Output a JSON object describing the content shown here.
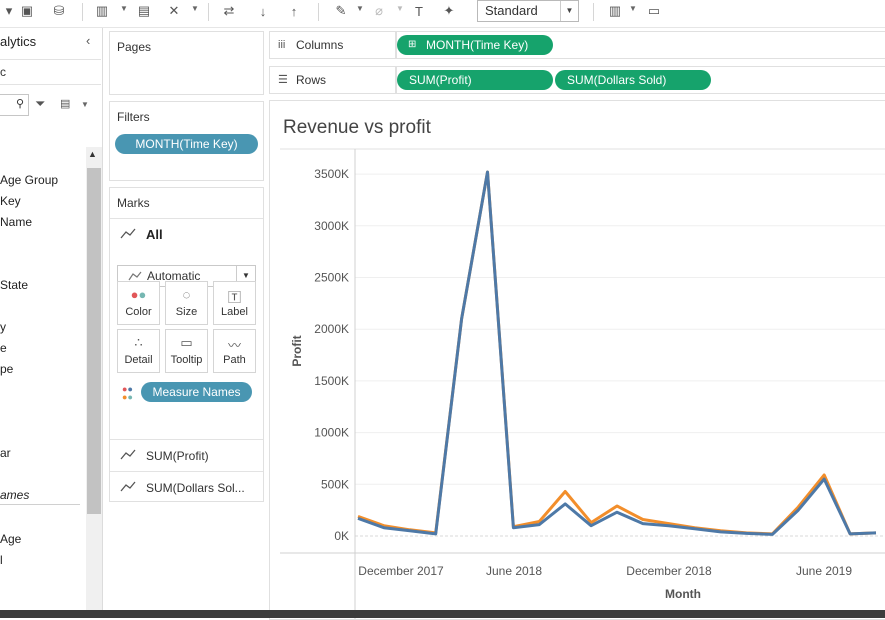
{
  "toolbar": {
    "view_size_select": "Standard"
  },
  "left_pane": {
    "title": "alytics",
    "search_text": "c",
    "field_list": [
      "Age Group",
      "Key",
      "Name",
      "State",
      "y",
      "e",
      "pe",
      "ar",
      "ames",
      "Age",
      "l"
    ]
  },
  "cards": {
    "pages": "Pages",
    "filters": "Filters",
    "filters_pill": "MONTH(Time Key)",
    "marks": "Marks",
    "marks_all": "All",
    "mark_type": "Automatic",
    "mark_buttons": {
      "color": "Color",
      "size": "Size",
      "label": "Label",
      "detail": "Detail",
      "tooltip": "Tooltip",
      "path": "Path"
    },
    "measure_names_pill": "Measure Names",
    "measure_rows": [
      "SUM(Profit)",
      "SUM(Dollars Sol..."
    ]
  },
  "shelves": {
    "columns_label": "Columns",
    "rows_label": "Rows",
    "columns_pill": "MONTH(Time Key)",
    "rows_pills": [
      "SUM(Profit)",
      "SUM(Dollars Sold)"
    ]
  },
  "colors": {
    "pill_blue": "#4996b2",
    "pill_green": "#16a36c",
    "series_blue": "#4e79a7",
    "series_orange": "#f28e2b"
  },
  "chart_data": {
    "type": "line",
    "title": "Revenue vs profit",
    "xlabel": "Month",
    "ylabel": "Profit",
    "x_tick_labels": [
      "December 2017",
      "June 2018",
      "December 2018",
      "June 2019"
    ],
    "y_tick_labels": [
      "0K",
      "500K",
      "1000K",
      "1500K",
      "2000K",
      "2500K",
      "3000K",
      "3500K"
    ],
    "ylim": [
      0,
      3600000
    ],
    "grid": true,
    "x": [
      "2017-10",
      "2017-11",
      "2017-12",
      "2018-01",
      "2018-02",
      "2018-03",
      "2018-04",
      "2018-05",
      "2018-06",
      "2018-07",
      "2018-08",
      "2018-09",
      "2018-10",
      "2018-11",
      "2018-12",
      "2019-01",
      "2019-02",
      "2019-03",
      "2019-04",
      "2019-05",
      "2019-06",
      "2019-07",
      "2019-08"
    ],
    "series": [
      {
        "name": "SUM(Dollars Sold)",
        "values": [
          190000,
          100000,
          60000,
          30000,
          2100000,
          3520000,
          90000,
          140000,
          430000,
          130000,
          290000,
          160000,
          120000,
          80000,
          50000,
          30000,
          20000,
          280000,
          590000,
          20000,
          30000,
          null,
          null
        ]
      },
      {
        "name": "SUM(Profit)",
        "values": [
          170000,
          80000,
          50000,
          20000,
          2100000,
          3520000,
          80000,
          110000,
          310000,
          100000,
          230000,
          120000,
          100000,
          70000,
          40000,
          25000,
          15000,
          250000,
          550000,
          20000,
          30000,
          null,
          null
        ]
      }
    ]
  }
}
